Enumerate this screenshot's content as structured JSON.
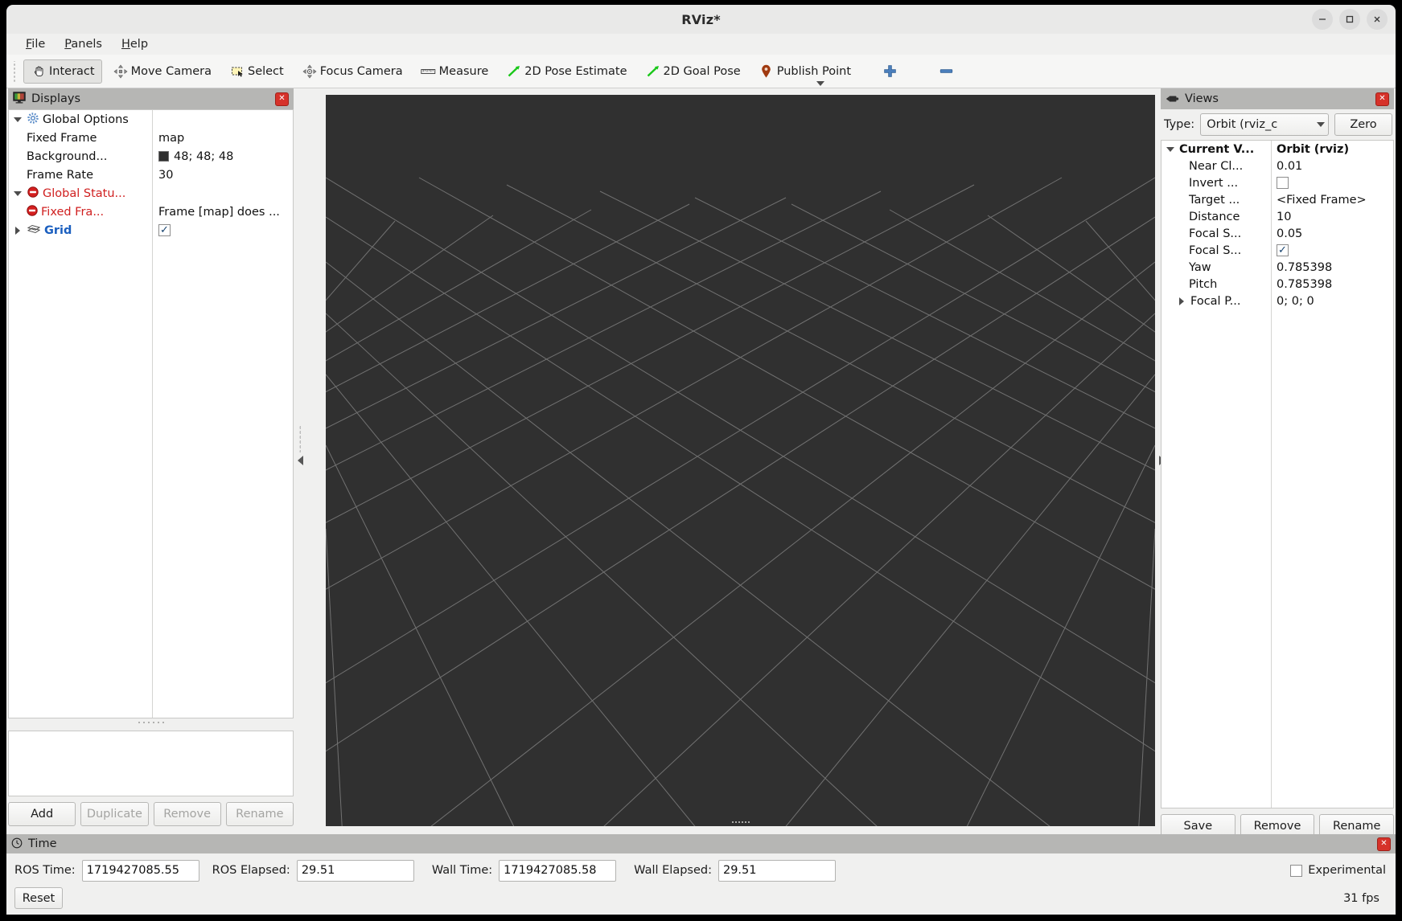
{
  "window": {
    "title": "RViz*",
    "controls": {
      "minimize": "minimize-icon",
      "maximize": "maximize-icon",
      "close": "close-icon"
    }
  },
  "menubar": {
    "items": [
      {
        "label": "File",
        "mnemonic": "F"
      },
      {
        "label": "Panels",
        "mnemonic": "P"
      },
      {
        "label": "Help",
        "mnemonic": "H"
      }
    ]
  },
  "toolbar": {
    "buttons": [
      {
        "label": "Interact",
        "icon": "hand-cursor-icon",
        "active": true
      },
      {
        "label": "Move Camera",
        "icon": "move-camera-icon",
        "active": false
      },
      {
        "label": "Select",
        "icon": "select-rect-icon",
        "active": false
      },
      {
        "label": "Focus Camera",
        "icon": "focus-camera-icon",
        "active": false
      },
      {
        "label": "Measure",
        "icon": "ruler-icon",
        "active": false
      },
      {
        "label": "2D Pose Estimate",
        "icon": "green-arrow-icon",
        "active": false
      },
      {
        "label": "2D Goal Pose",
        "icon": "green-arrow-icon",
        "active": false
      },
      {
        "label": "Publish Point",
        "icon": "map-pin-icon",
        "active": false
      },
      {
        "label": "",
        "icon": "plus-icon",
        "active": false
      },
      {
        "label": "",
        "icon": "minus-icon",
        "active": false
      }
    ],
    "overflow": "toolbar-overflow-arrow"
  },
  "displays": {
    "title": "Displays",
    "icon": "displays-monitor-icon",
    "close_icon": "panel-close-icon",
    "rows": [
      {
        "id": "global-options",
        "label": "Global Options",
        "value": "",
        "twisty": "open",
        "indent": 0,
        "icon": "gear-icon",
        "style": "plain"
      },
      {
        "id": "fixed-frame",
        "label": "Fixed Frame",
        "value": "map",
        "twisty": "none",
        "indent": 1,
        "icon": "",
        "style": "plain"
      },
      {
        "id": "background-color",
        "label": "Background...",
        "value": "48; 48; 48",
        "twisty": "none",
        "indent": 1,
        "icon": "",
        "style": "swatch"
      },
      {
        "id": "frame-rate",
        "label": "Frame Rate",
        "value": "30",
        "twisty": "none",
        "indent": 1,
        "icon": "",
        "style": "plain"
      },
      {
        "id": "global-status",
        "label": "Global Statu...",
        "value": "",
        "twisty": "open",
        "indent": 0,
        "icon": "error-icon",
        "style": "error"
      },
      {
        "id": "fixed-frame-status",
        "label": "Fixed Fra...",
        "value": "Frame [map] does ...",
        "twisty": "none",
        "indent": 1,
        "icon": "error-icon",
        "style": "error"
      },
      {
        "id": "grid",
        "label": "Grid",
        "value": "checked",
        "twisty": "closed",
        "indent": 0,
        "icon": "grid-icon",
        "style": "link"
      }
    ],
    "buttons": [
      {
        "label": "Add",
        "enabled": true
      },
      {
        "label": "Duplicate",
        "enabled": false
      },
      {
        "label": "Remove",
        "enabled": false
      },
      {
        "label": "Rename",
        "enabled": false
      }
    ]
  },
  "views": {
    "title": "Views",
    "icon": "views-camera-icon",
    "close_icon": "panel-close-icon",
    "type_label": "Type:",
    "type_value": "Orbit (rviz_c",
    "zero_button": "Zero",
    "rows": [
      {
        "id": "current-view",
        "label": "Current V...",
        "value": "Orbit (rviz)",
        "twisty": "open",
        "bold": true
      },
      {
        "id": "near-clip",
        "label": "Near Cl...",
        "value": "0.01",
        "twisty": "none",
        "bold": false
      },
      {
        "id": "invert-y",
        "label": "Invert ...",
        "value": "unchecked",
        "twisty": "none",
        "bold": false,
        "kind": "checkbox"
      },
      {
        "id": "target-frame",
        "label": "Target ...",
        "value": "<Fixed Frame>",
        "twisty": "none",
        "bold": false
      },
      {
        "id": "distance",
        "label": "Distance",
        "value": "10",
        "twisty": "none",
        "bold": false
      },
      {
        "id": "focal-shape-size",
        "label": "Focal S...",
        "value": "0.05",
        "twisty": "none",
        "bold": false
      },
      {
        "id": "focal-shape-fixed",
        "label": "Focal S...",
        "value": "checked",
        "twisty": "none",
        "bold": false,
        "kind": "checkbox"
      },
      {
        "id": "yaw",
        "label": "Yaw",
        "value": "0.785398",
        "twisty": "none",
        "bold": false
      },
      {
        "id": "pitch",
        "label": "Pitch",
        "value": "0.785398",
        "twisty": "none",
        "bold": false
      },
      {
        "id": "focal-point",
        "label": "Focal P...",
        "value": "0; 0; 0",
        "twisty": "closed",
        "bold": false
      }
    ],
    "buttons": [
      {
        "label": "Save",
        "enabled": true
      },
      {
        "label": "Remove",
        "enabled": true
      },
      {
        "label": "Rename",
        "enabled": true
      }
    ]
  },
  "viewport": {
    "background_color": "#303030",
    "grid_line_color": "#9a9a9a"
  },
  "time": {
    "title": "Time",
    "icon": "clock-icon",
    "close_icon": "panel-close-icon",
    "fields": [
      {
        "id": "ros-time",
        "label": "ROS Time:",
        "value": "1719427085.55"
      },
      {
        "id": "ros-elapsed",
        "label": "ROS Elapsed:",
        "value": "29.51"
      },
      {
        "id": "wall-time",
        "label": "Wall Time:",
        "value": "1719427085.58"
      },
      {
        "id": "wall-elapsed",
        "label": "Wall Elapsed:",
        "value": "29.51"
      }
    ],
    "experimental_label": "Experimental",
    "experimental_checked": false,
    "reset_button": "Reset",
    "fps": "31 fps"
  }
}
